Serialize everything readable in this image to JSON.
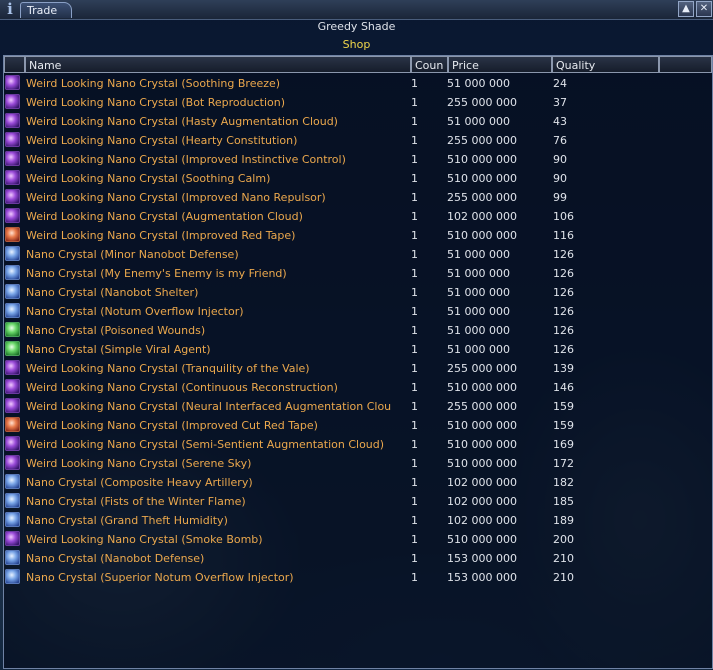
{
  "window": {
    "tab_label": "Trade",
    "info_glyph": "i",
    "pin_glyph": "▲",
    "close_glyph": "✕",
    "icons": {
      "info": "info-icon",
      "pin": "pin-icon",
      "close": "close-icon"
    }
  },
  "vendor": {
    "name": "Greedy Shade",
    "type": "Shop"
  },
  "colors": {
    "item_name": "#eba84d",
    "shop_label": "#f0d64a",
    "text": "#dfe3ea"
  },
  "table": {
    "columns": [
      "",
      "Name",
      "Coun",
      "Price",
      "Quality"
    ],
    "rows": [
      {
        "icon": "weird",
        "name": "Weird Looking Nano Crystal (Soothing Breeze)",
        "count": "1",
        "price": "51 000 000",
        "quality": "24"
      },
      {
        "icon": "weird",
        "name": "Weird Looking Nano Crystal (Bot Reproduction)",
        "count": "1",
        "price": "255 000 000",
        "quality": "37"
      },
      {
        "icon": "weird",
        "name": "Weird Looking Nano Crystal (Hasty Augmentation Cloud)",
        "count": "1",
        "price": "51 000 000",
        "quality": "43"
      },
      {
        "icon": "weird",
        "name": "Weird Looking Nano Crystal (Hearty Constitution)",
        "count": "1",
        "price": "255 000 000",
        "quality": "76"
      },
      {
        "icon": "weird",
        "name": "Weird Looking Nano Crystal (Improved Instinctive Control)",
        "count": "1",
        "price": "510 000 000",
        "quality": "90"
      },
      {
        "icon": "weird",
        "name": "Weird Looking Nano Crystal (Soothing Calm)",
        "count": "1",
        "price": "510 000 000",
        "quality": "90"
      },
      {
        "icon": "weird",
        "name": "Weird Looking Nano Crystal (Improved Nano Repulsor)",
        "count": "1",
        "price": "255 000 000",
        "quality": "99"
      },
      {
        "icon": "weird",
        "name": "Weird Looking Nano Crystal (Augmentation Cloud)",
        "count": "1",
        "price": "102 000 000",
        "quality": "106"
      },
      {
        "icon": "red",
        "name": "Weird Looking Nano Crystal (Improved Red Tape)",
        "count": "1",
        "price": "510 000 000",
        "quality": "116"
      },
      {
        "icon": "blue",
        "name": "Nano Crystal (Minor Nanobot Defense)",
        "count": "1",
        "price": "51 000 000",
        "quality": "126"
      },
      {
        "icon": "blue",
        "name": "Nano Crystal (My Enemy's Enemy is my Friend)",
        "count": "1",
        "price": "51 000 000",
        "quality": "126"
      },
      {
        "icon": "blue",
        "name": "Nano Crystal (Nanobot Shelter)",
        "count": "1",
        "price": "51 000 000",
        "quality": "126"
      },
      {
        "icon": "blue",
        "name": "Nano Crystal (Notum Overflow Injector)",
        "count": "1",
        "price": "51 000 000",
        "quality": "126"
      },
      {
        "icon": "green",
        "name": "Nano Crystal (Poisoned Wounds)",
        "count": "1",
        "price": "51 000 000",
        "quality": "126"
      },
      {
        "icon": "green",
        "name": "Nano Crystal (Simple Viral Agent)",
        "count": "1",
        "price": "51 000 000",
        "quality": "126"
      },
      {
        "icon": "weird",
        "name": "Weird Looking Nano Crystal (Tranquility of the Vale)",
        "count": "1",
        "price": "255 000 000",
        "quality": "139"
      },
      {
        "icon": "weird",
        "name": "Weird Looking Nano Crystal (Continuous Reconstruction)",
        "count": "1",
        "price": "510 000 000",
        "quality": "146"
      },
      {
        "icon": "weird",
        "name": "Weird Looking Nano Crystal (Neural Interfaced Augmentation Clou",
        "count": "1",
        "price": "255 000 000",
        "quality": "159"
      },
      {
        "icon": "red",
        "name": "Weird Looking Nano Crystal (Improved Cut Red Tape)",
        "count": "1",
        "price": "510 000 000",
        "quality": "159"
      },
      {
        "icon": "weird",
        "name": "Weird Looking Nano Crystal (Semi-Sentient Augmentation Cloud)",
        "count": "1",
        "price": "510 000 000",
        "quality": "169"
      },
      {
        "icon": "weird",
        "name": "Weird Looking Nano Crystal (Serene Sky)",
        "count": "1",
        "price": "510 000 000",
        "quality": "172"
      },
      {
        "icon": "blue",
        "name": "Nano Crystal (Composite Heavy Artillery)",
        "count": "1",
        "price": "102 000 000",
        "quality": "182"
      },
      {
        "icon": "blue",
        "name": "Nano Crystal (Fists of the Winter Flame)",
        "count": "1",
        "price": "102 000 000",
        "quality": "185"
      },
      {
        "icon": "blue",
        "name": "Nano Crystal (Grand Theft Humidity)",
        "count": "1",
        "price": "102 000 000",
        "quality": "189"
      },
      {
        "icon": "weird",
        "name": "Weird Looking Nano Crystal (Smoke Bomb)",
        "count": "1",
        "price": "510 000 000",
        "quality": "200"
      },
      {
        "icon": "blue",
        "name": "Nano Crystal (Nanobot Defense)",
        "count": "1",
        "price": "153 000 000",
        "quality": "210"
      },
      {
        "icon": "blue",
        "name": "Nano Crystal (Superior Notum Overflow Injector)",
        "count": "1",
        "price": "153 000 000",
        "quality": "210"
      }
    ]
  }
}
